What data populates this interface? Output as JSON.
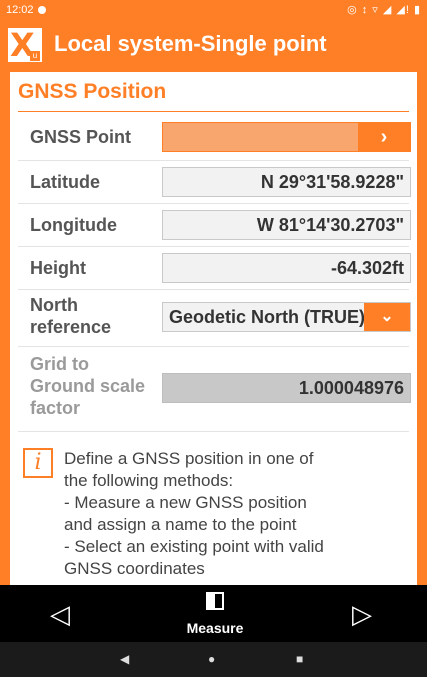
{
  "status_bar": {
    "time": "12:02",
    "icons": "◎ ↕ ▿ ◢ ◢! ▮"
  },
  "app_bar": {
    "logo_letter": "X",
    "logo_sub": "u",
    "title": "Local system-Single point"
  },
  "section": {
    "title": "GNSS Position"
  },
  "fields": {
    "gnss_point": {
      "label": "GNSS Point",
      "value": "",
      "button": "›"
    },
    "latitude": {
      "label": "Latitude",
      "value": "N 29°31'58.9228\""
    },
    "longitude": {
      "label": "Longitude",
      "value": "W 81°14'30.2703\""
    },
    "height": {
      "label": "Height",
      "value": "-64.302ft"
    },
    "north_reference": {
      "label_line1": "North",
      "label_line2": "reference",
      "value": "Geodetic North (TRUE)",
      "button": "⌄"
    },
    "grid_to_ground": {
      "label_line1": "Grid to",
      "label_line2": "Ground scale",
      "label_line3": "factor",
      "value": "1.000048976"
    }
  },
  "info": {
    "icon": "i",
    "lines": [
      "Define a GNSS position in one of",
      "the following methods:",
      "- Measure a new GNSS position",
      "and assign a name to the point",
      "- Select an existing point with valid",
      "GNSS coordinates"
    ]
  },
  "bottom_bar": {
    "prev": "◁",
    "measure_label": "Measure",
    "next": "▷"
  },
  "nav_bar": {
    "back": "◀",
    "home": "●",
    "recents": "■"
  },
  "colors": {
    "accent": "#ff7f27",
    "field_bg": "#f2f2f2",
    "disabled_field": "#c8c8c8"
  }
}
